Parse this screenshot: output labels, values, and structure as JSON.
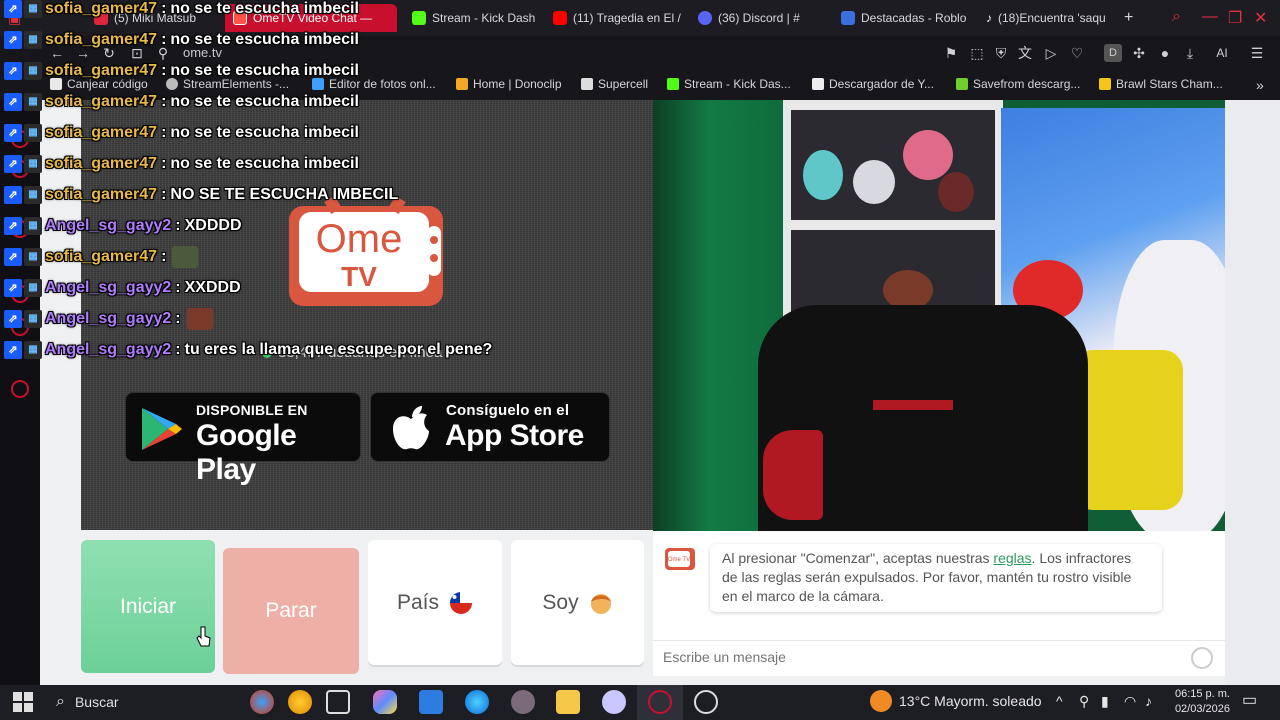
{
  "browser": {
    "tabs": [
      {
        "label": "(5) Miki Matsub",
        "color": "#e0263c"
      },
      {
        "label": "OmeTV Video Chat —",
        "color": "#ff5544"
      },
      {
        "label": "Stream - Kick Dash",
        "color": "#53fc18"
      },
      {
        "label": "(11) Tragedia en El /",
        "color": "#ff0000"
      },
      {
        "label": "(36) Discord | #",
        "color": "#5865f2"
      },
      {
        "label": "Destacadas - Roblo",
        "color": "#3b6fe0"
      },
      {
        "label": "(18)Encuentra 'saqu",
        "color": "#ffffff"
      }
    ],
    "new_tab": "+",
    "url": "ome.tv",
    "ai_label": "AI",
    "bookmarks": [
      {
        "label": "Canjear código",
        "color": "#e8e8e8"
      },
      {
        "label": "StreamElements -...",
        "color": "#bbbbbb"
      },
      {
        "label": "Editor de fotos onl...",
        "color": "#3da0ff"
      },
      {
        "label": "Home | Donoclip",
        "color": "#f5a623"
      },
      {
        "label": "Supercell",
        "color": "#dddddd"
      },
      {
        "label": "Stream - Kick Das...",
        "color": "#53fc18"
      },
      {
        "label": "Descargador de Y...",
        "color": "#eeeeee"
      },
      {
        "label": "Savefrom descarg...",
        "color": "#6fcf2f"
      },
      {
        "label": "Brawl Stars Cham...",
        "color": "#f5c518"
      }
    ],
    "more_bookmarks": "»"
  },
  "ometv": {
    "logo_line1": "Ome",
    "logo_line2": "TV",
    "online_text": "33,497 usuarios en línea",
    "google_play_small": "DISPONIBLE EN",
    "google_play_big": "Google Play",
    "app_store_small": "Consíguelo en el",
    "app_store_big": "App Store",
    "start_label": "Iniciar",
    "stop_label": "Parar",
    "country_label": "País",
    "me_label": "Soy",
    "system_message_before": "Al presionar \"Comenzar\", aceptas nuestras ",
    "system_message_link": "reglas",
    "system_message_after": ". Los infractores de las reglas serán expulsados. Por favor, mantén tu rostro visible en el marco de la cámara.",
    "message_placeholder": "Escribe un mensaje",
    "chat_avatar_text": "Ome TV"
  },
  "chat": [
    {
      "user": "sofia_gamer47",
      "text": "no se te escucha imbecil",
      "style": "gold"
    },
    {
      "user": "sofia_gamer47",
      "text": "no se te escucha imbecil",
      "style": "gold"
    },
    {
      "user": "sofia_gamer47",
      "text": "no se te escucha imbecil",
      "style": "gold"
    },
    {
      "user": "sofia_gamer47",
      "text": "no se te escucha imbecil",
      "style": "gold"
    },
    {
      "user": "sofia_gamer47",
      "text": "no se te escucha imbecil",
      "style": "gold"
    },
    {
      "user": "sofia_gamer47",
      "text": "no se te escucha imbecil",
      "style": "gold"
    },
    {
      "user": "sofia_gamer47",
      "text": "NO SE TE ESCUCHA IMBECIL",
      "style": "gold"
    },
    {
      "user": "Angel_sg_gayy2",
      "text": "XDDDD",
      "style": "purple"
    },
    {
      "user": "sofia_gamer47",
      "text": "",
      "style": "gold",
      "emote": "#4a5a3a"
    },
    {
      "user": "Angel_sg_gayy2",
      "text": "XXDDD",
      "style": "purple"
    },
    {
      "user": "Angel_sg_gayy2",
      "text": "",
      "style": "purple",
      "emote": "#7a3a2a"
    },
    {
      "user": "Angel_sg_gayy2",
      "text": "tu eres la llama que escupe por el pene?",
      "style": "purple"
    }
  ],
  "taskbar": {
    "search_label": "Buscar",
    "weather": "13°C  Mayorm. soleado",
    "time": "06:15 p. m.",
    "date": "02/03/2026"
  },
  "colors": {
    "ometv_red": "#d9563f",
    "start_green": "#74d49e",
    "stop_salmon": "#eeb0a6",
    "browser_accent": "#c8102e"
  }
}
